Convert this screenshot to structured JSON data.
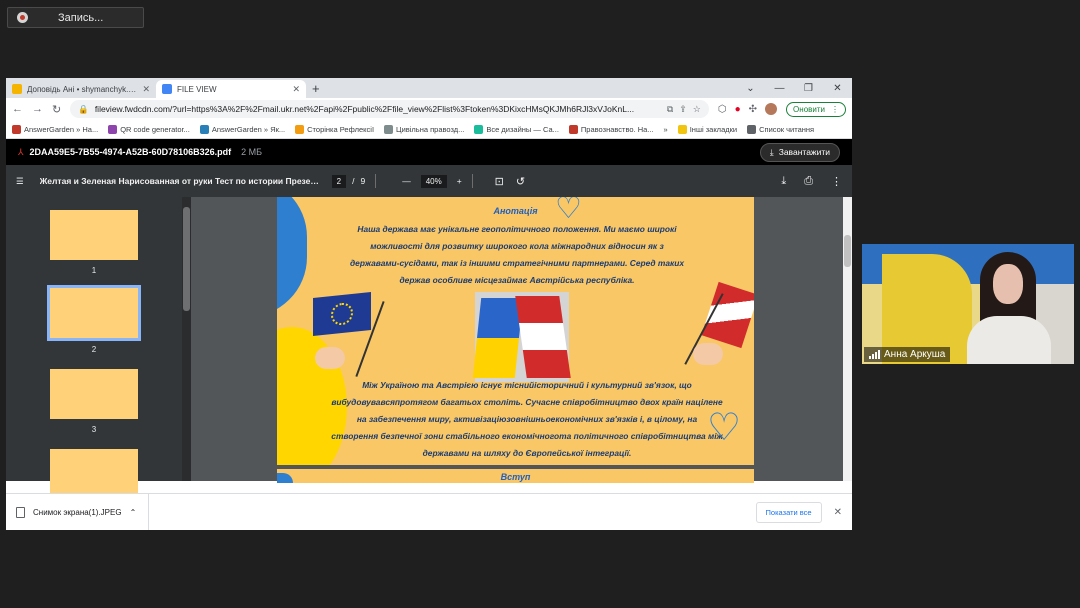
{
  "recording": {
    "label": "Запись..."
  },
  "browser": {
    "tabs": [
      {
        "label": "Доповідь Ані • shymanchyk.yaro",
        "active": false,
        "favicon_color": "#f4b400"
      },
      {
        "label": "FILE VIEW",
        "active": true,
        "favicon_color": "#4285f4"
      }
    ],
    "new_tab": "+",
    "window_controls": [
      "⌄",
      "—",
      "❐",
      "✕"
    ],
    "url": "fileview.fwdcdn.com/?url=https%3A%2F%2Fmail.ukr.net%2Fapi%2Fpublic%2Ffile_view%2Flist%3Ftoken%3DKixcHMsQKJMh6RJl3xVJoKnL...",
    "update_label": "Оновити",
    "bookmarks": [
      {
        "label": "AnswerGarden » Ha...",
        "color": "#c0392b"
      },
      {
        "label": "QR code generator...",
        "color": "#8e44ad"
      },
      {
        "label": "AnswerGarden » Як...",
        "color": "#2980b9"
      },
      {
        "label": "Сторінка Рефлексії",
        "color": "#f39c12"
      },
      {
        "label": "Цивільна правозд...",
        "color": "#7f8c8d"
      },
      {
        "label": "Все дизайны — Са...",
        "color": "#1abc9c"
      },
      {
        "label": "Правознавство. На...",
        "color": "#c0392b"
      },
      {
        "label": "»",
        "color": ""
      },
      {
        "label": "Інші закладки",
        "color": "#f1c40f"
      },
      {
        "label": "Список читання",
        "color": "#5f6368"
      }
    ]
  },
  "pdf": {
    "file_name": "2DAA59E5-7B55-4974-A52B-60D78106B326.pdf",
    "file_size": "2 МБ",
    "download_label": "Завантажити",
    "doc_title": "Желтая и Зеленая Нарисованная от руки Тест по истории Презент...",
    "current_page": "2",
    "page_separator": "/",
    "total_pages": "9",
    "zoom": "40%",
    "thumbnails": [
      "1",
      "2",
      "3"
    ],
    "slide": {
      "title": "Анотація",
      "paragraph1": [
        "Наша держава має унікальне геополітичного положення. Ми маємо широкі",
        "можливості для розвитку широкого кола міжнародних відносин як з",
        "державами-сусідами, так із іншими стратегічними партнерами. Серед таких",
        "держав особливе місцезаймає Австрійська республіка."
      ],
      "paragraph2": [
        "Між Україною та Австрією існує тіснийісторичний і культурний зв'язок, що",
        "вибудовувавсяпротягом багатьох століть. Сучасне співробітництво двох країн націлене",
        "на забезпечення миру, активізаціюзовнішньоекономічних зв'язків і, в цілому, на",
        "створення безпечної зони стабільного економічногота політичного співробітництва між",
        "державами на шляху до Європейської інтеграції."
      ],
      "next_slide_title": "Вступ"
    }
  },
  "downloads": {
    "file": "Снимок экрана(1).JPEG",
    "show_all": "Показати все"
  },
  "video": {
    "participant": "Анна Аркуша"
  }
}
